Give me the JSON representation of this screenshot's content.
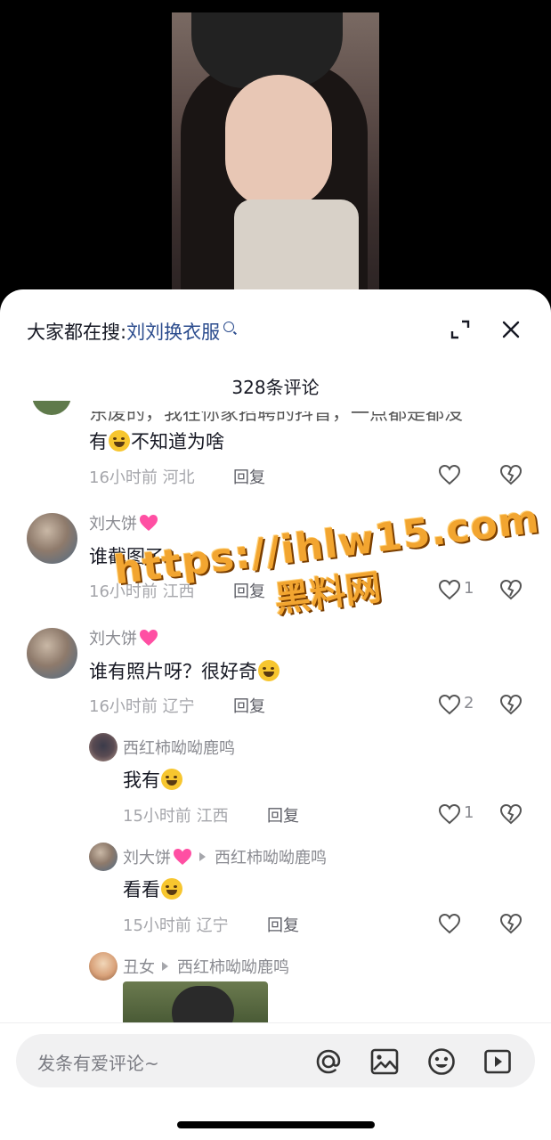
{
  "search": {
    "prefix": "大家都在搜:",
    "term": "刘刘换衣服"
  },
  "header": {
    "count_title": "328条评论"
  },
  "comments": [
    {
      "partial_line": "东废的，我在你家招聘的抖音，一点都是都没",
      "text_before": "有",
      "text_after": "不知道为啥",
      "time": "16小时前",
      "location": "河北",
      "reply_label": "回复",
      "likes": ""
    },
    {
      "author": "刘大饼",
      "text": "谁截图了?",
      "time": "16小时前",
      "location": "江西",
      "reply_label": "回复",
      "likes": "1"
    },
    {
      "author": "刘大饼",
      "text": "谁有照片呀？很好奇",
      "time": "16小时前",
      "location": "辽宁",
      "reply_label": "回复",
      "likes": "2"
    }
  ],
  "replies": [
    {
      "author": "西红柿呦呦鹿鸣",
      "text": "我有",
      "time": "15小时前",
      "location": "江西",
      "reply_label": "回复",
      "likes": "1"
    },
    {
      "author": "刘大饼",
      "reply_to": "西红柿呦呦鹿鸣",
      "text": "看看",
      "time": "15小时前",
      "location": "辽宁",
      "reply_label": "回复",
      "likes": ""
    },
    {
      "author": "丑女",
      "reply_to": "西红柿呦呦鹿鸣"
    }
  ],
  "watermark": {
    "url": "https://ihlw15.com",
    "site": "黑料网"
  },
  "input": {
    "placeholder": "发条有爱评论~"
  },
  "colors": {
    "link_blue": "#2a4b8d",
    "watermark_orange": "#f2a530",
    "pink_heart": "#ff4fa3"
  }
}
